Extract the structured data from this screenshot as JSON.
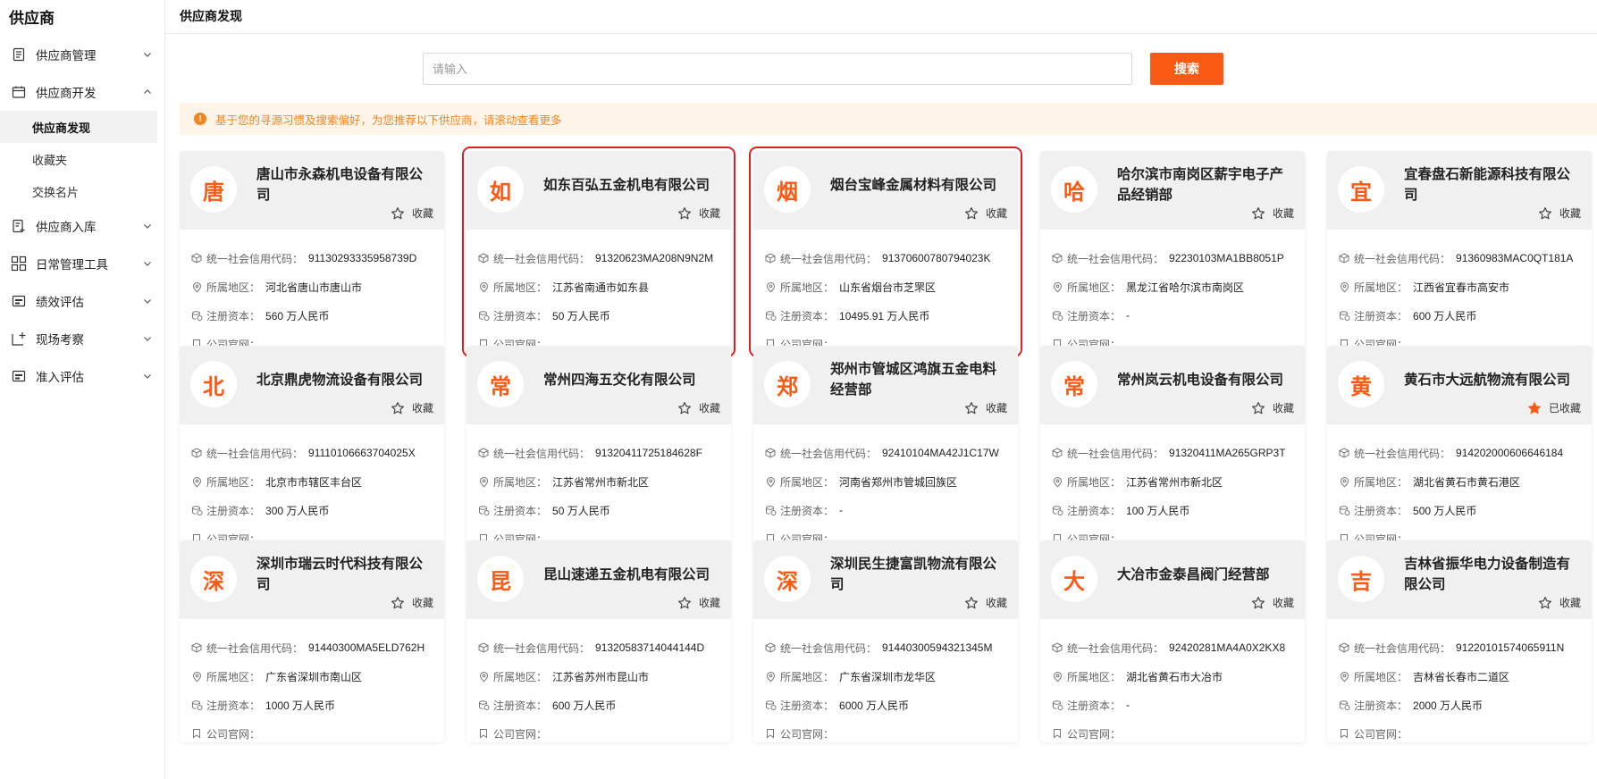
{
  "sidebar": {
    "brand": "供应商",
    "menu": [
      {
        "label": "供应商管理",
        "icon": "document-icon",
        "expanded": false
      },
      {
        "label": "供应商开发",
        "icon": "calendar-icon",
        "expanded": true,
        "children": [
          {
            "label": "供应商发现",
            "active": true
          },
          {
            "label": "收藏夹",
            "active": false
          },
          {
            "label": "交换名片",
            "active": false
          }
        ]
      },
      {
        "label": "供应商入库",
        "icon": "doc-add-icon",
        "expanded": false
      },
      {
        "label": "日常管理工具",
        "icon": "grid-icon",
        "expanded": false
      },
      {
        "label": "绩效评估",
        "icon": "chart-card-icon",
        "expanded": false
      },
      {
        "label": "现场考察",
        "icon": "site-icon",
        "expanded": false
      },
      {
        "label": "准入评估",
        "icon": "chart-card-icon",
        "expanded": false
      }
    ]
  },
  "header": {
    "title": "供应商发现"
  },
  "search": {
    "placeholder": "请输入",
    "value": "",
    "button": "搜索"
  },
  "notice": {
    "text": "基于您的寻源习惯及搜索偏好，为您推荐以下供应商，请滚动查看更多"
  },
  "field_labels": {
    "credit_code": "统一社会信用代码：",
    "region": "所属地区：",
    "capital": "注册资本：",
    "website": "公司官网："
  },
  "fav_labels": {
    "add": "收藏",
    "added": "已收藏"
  },
  "colors": {
    "accent": "#fa5a14",
    "notice_text": "#f5851f",
    "notice_bg": "#fff4e8",
    "highlight": "#e02020"
  },
  "cards": [
    {
      "avatar": "唐",
      "name": "唐山市永森机电设备有限公司",
      "credit_code": "91130293335958739D",
      "region": "河北省唐山市唐山市",
      "capital": "560 万人民币",
      "website": "",
      "favorited": false,
      "highlight": false
    },
    {
      "avatar": "如",
      "name": "如东百弘五金机电有限公司",
      "credit_code": "91320623MA208N9N2M",
      "region": "江苏省南通市如东县",
      "capital": "50 万人民币",
      "website": "",
      "favorited": false,
      "highlight": true
    },
    {
      "avatar": "烟",
      "name": "烟台宝峰金属材料有限公司",
      "credit_code": "91370600780794023K",
      "region": "山东省烟台市芝罘区",
      "capital": "10495.91 万人民币",
      "website": "",
      "favorited": false,
      "highlight": true
    },
    {
      "avatar": "哈",
      "name": "哈尔滨市南岗区薪宇电子产品经销部",
      "credit_code": "92230103MA1BB8051P",
      "region": "黑龙江省哈尔滨市南岗区",
      "capital": "-",
      "website": "",
      "favorited": false,
      "highlight": false
    },
    {
      "avatar": "宜",
      "name": "宜春盘石新能源科技有限公司",
      "credit_code": "91360983MAC0QT181A",
      "region": "江西省宜春市高安市",
      "capital": "600 万人民币",
      "website": "",
      "favorited": false,
      "highlight": false
    },
    {
      "avatar": "北",
      "name": "北京鼎虎物流设备有限公司",
      "credit_code": "91110106663704025X",
      "region": "北京市市辖区丰台区",
      "capital": "300 万人民币",
      "website": "",
      "favorited": false,
      "highlight": false
    },
    {
      "avatar": "常",
      "name": "常州四海五交化有限公司",
      "credit_code": "91320411725184628F",
      "region": "江苏省常州市新北区",
      "capital": "50 万人民币",
      "website": "",
      "favorited": false,
      "highlight": false
    },
    {
      "avatar": "郑",
      "name": "郑州市管城区鸿旗五金电料经营部",
      "credit_code": "92410104MA42J1C17W",
      "region": "河南省郑州市管城回族区",
      "capital": "-",
      "website": "",
      "favorited": false,
      "highlight": false
    },
    {
      "avatar": "常",
      "name": "常州岚云机电设备有限公司",
      "credit_code": "91320411MA265GRP3T",
      "region": "江苏省常州市新北区",
      "capital": "100 万人民币",
      "website": "",
      "favorited": false,
      "highlight": false
    },
    {
      "avatar": "黄",
      "name": "黄石市大远航物流有限公司",
      "credit_code": "914202000606646184",
      "region": "湖北省黄石市黄石港区",
      "capital": "500 万人民币",
      "website": "",
      "favorited": true,
      "highlight": false
    },
    {
      "avatar": "深",
      "name": "深圳市瑞云时代科技有限公司",
      "credit_code": "91440300MA5ELD762H",
      "region": "广东省深圳市南山区",
      "capital": "1000 万人民币",
      "website": "",
      "favorited": false,
      "highlight": false
    },
    {
      "avatar": "昆",
      "name": "昆山速递五金机电有限公司",
      "credit_code": "91320583714044144D",
      "region": "江苏省苏州市昆山市",
      "capital": "600 万人民币",
      "website": "",
      "favorited": false,
      "highlight": false
    },
    {
      "avatar": "深",
      "name": "深圳民生捷富凯物流有限公司",
      "credit_code": "91440300594321345M",
      "region": "广东省深圳市龙华区",
      "capital": "6000 万人民币",
      "website": "",
      "favorited": false,
      "highlight": false
    },
    {
      "avatar": "大",
      "name": "大冶市金泰昌阀门经营部",
      "credit_code": "92420281MA4A0X2KX8",
      "region": "湖北省黄石市大冶市",
      "capital": "-",
      "website": "",
      "favorited": false,
      "highlight": false
    },
    {
      "avatar": "吉",
      "name": "吉林省振华电力设备制造有限公司",
      "credit_code": "91220101574065911N",
      "region": "吉林省长春市二道区",
      "capital": "2000 万人民币",
      "website": "",
      "favorited": false,
      "highlight": false
    }
  ]
}
